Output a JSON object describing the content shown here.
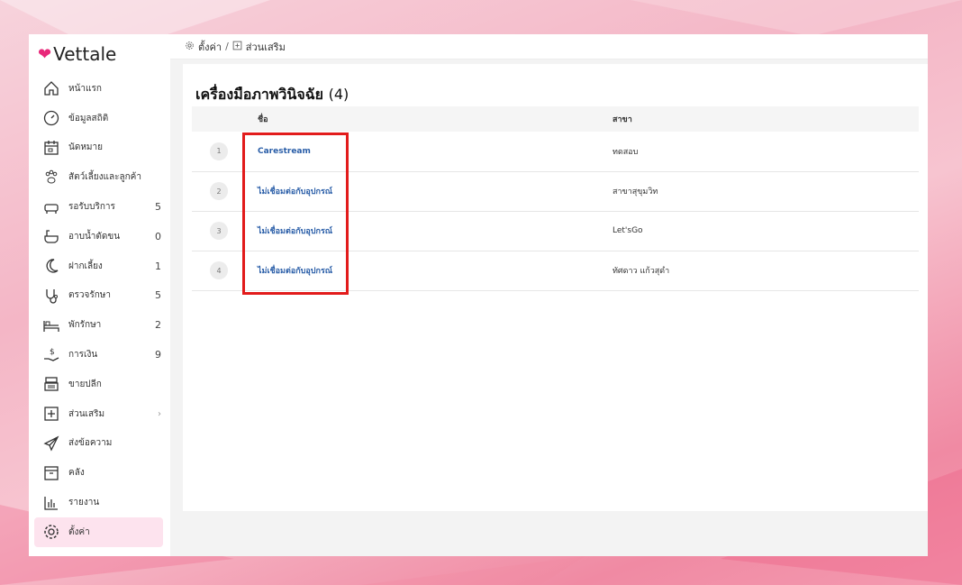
{
  "app": {
    "name": "Vettale"
  },
  "breadcrumb": {
    "parent": "ตั้งค่า",
    "separator": "/",
    "current": "ส่วนเสริม"
  },
  "sidebar": {
    "items": [
      {
        "label": "หน้าแรก",
        "icon": "home-icon",
        "count": ""
      },
      {
        "label": "ข้อมูลสถิติ",
        "icon": "dashboard-gauge-icon",
        "count": ""
      },
      {
        "label": "นัดหมาย",
        "icon": "calendar-icon",
        "count": ""
      },
      {
        "label": "สัตว์เลี้ยงและลูกค้า",
        "icon": "paw-icon",
        "count": ""
      },
      {
        "label": "รอรับบริการ",
        "icon": "sofa-icon",
        "count": "5"
      },
      {
        "label": "อาบน้ำตัดขน",
        "icon": "bathtub-icon",
        "count": "0"
      },
      {
        "label": "ฝากเลี้ยง",
        "icon": "moon-icon",
        "count": "1"
      },
      {
        "label": "ตรวจรักษา",
        "icon": "stethoscope-icon",
        "count": "5"
      },
      {
        "label": "พักรักษา",
        "icon": "bed-icon",
        "count": "2"
      },
      {
        "label": "การเงิน",
        "icon": "money-hand-icon",
        "count": "9"
      },
      {
        "label": "ขายปลีก",
        "icon": "cash-register-icon",
        "count": ""
      },
      {
        "label": "ส่วนเสริม",
        "icon": "plus-square-icon",
        "count": "",
        "chevron": "›"
      },
      {
        "label": "ส่งข้อความ",
        "icon": "send-icon",
        "count": ""
      },
      {
        "label": "คลัง",
        "icon": "archive-icon",
        "count": ""
      },
      {
        "label": "รายงาน",
        "icon": "bar-chart-icon",
        "count": ""
      },
      {
        "label": "ตั้งค่า",
        "icon": "gear-icon",
        "count": "",
        "active": true
      }
    ]
  },
  "panel": {
    "title": "เครื่องมือภาพวินิจฉัย",
    "count": "(4)",
    "columns": {
      "name": "ชื่อ",
      "branch": "สาขา"
    },
    "rows": [
      {
        "index": "1",
        "name": "Carestream",
        "branch": "ทดสอบ"
      },
      {
        "index": "2",
        "name": "ไม่เชื่อมต่อกับอุปกรณ์",
        "branch": "สาขาสุขุมวิท"
      },
      {
        "index": "3",
        "name": "ไม่เชื่อมต่อกับอุปกรณ์",
        "branch": "Let'sGo"
      },
      {
        "index": "4",
        "name": "ไม่เชื่อมต่อกับอุปกรณ์",
        "branch": "ทัศดาว แก้วสุดำ"
      }
    ]
  },
  "colors": {
    "accent": "#e8287a",
    "link": "#2a5ea8",
    "highlight": "#e21b1b",
    "active_bg": "#fde3ee"
  }
}
